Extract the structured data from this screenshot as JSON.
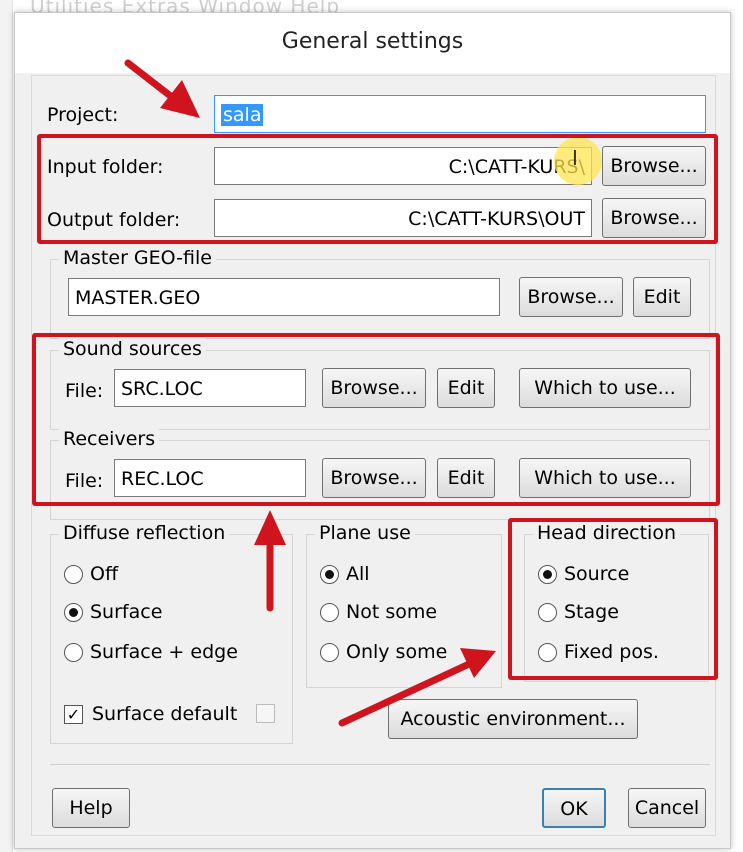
{
  "background": {
    "menu": "Utilities   Extras   Window   Help"
  },
  "window": {
    "title": "General settings"
  },
  "project": {
    "label": "Project:",
    "value": "sala"
  },
  "input_folder": {
    "label": "Input folder:",
    "value": "C:\\CATT-KURS\\",
    "browse": "Browse..."
  },
  "output_folder": {
    "label": "Output folder:",
    "value": "C:\\CATT-KURS\\OUT",
    "browse": "Browse..."
  },
  "master_geo": {
    "title": "Master GEO-file",
    "value": "MASTER.GEO",
    "browse": "Browse...",
    "edit": "Edit"
  },
  "sound_sources": {
    "title": "Sound sources",
    "file_label": "File:",
    "value": "SRC.LOC",
    "browse": "Browse...",
    "edit": "Edit",
    "which": "Which to use..."
  },
  "receivers": {
    "title": "Receivers",
    "file_label": "File:",
    "value": "REC.LOC",
    "browse": "Browse...",
    "edit": "Edit",
    "which": "Which to use..."
  },
  "diffuse_reflection": {
    "title": "Diffuse reflection",
    "options": [
      "Off",
      "Surface",
      "Surface + edge"
    ],
    "selected": "Surface",
    "surface_default_label": "Surface default",
    "surface_default_checked": true
  },
  "plane_use": {
    "title": "Plane use",
    "options": [
      "All",
      "Not some",
      "Only some"
    ],
    "selected": "All"
  },
  "head_direction": {
    "title": "Head direction",
    "options": [
      "Source",
      "Stage",
      "Fixed pos."
    ],
    "selected": "Source"
  },
  "acoustic_environment": {
    "label": "Acoustic environment..."
  },
  "footer": {
    "help": "Help",
    "ok": "OK",
    "cancel": "Cancel"
  },
  "colors": {
    "highlight": "#d0141e",
    "selection": "#3399ff",
    "default_button_border": "#3c7fb1"
  }
}
